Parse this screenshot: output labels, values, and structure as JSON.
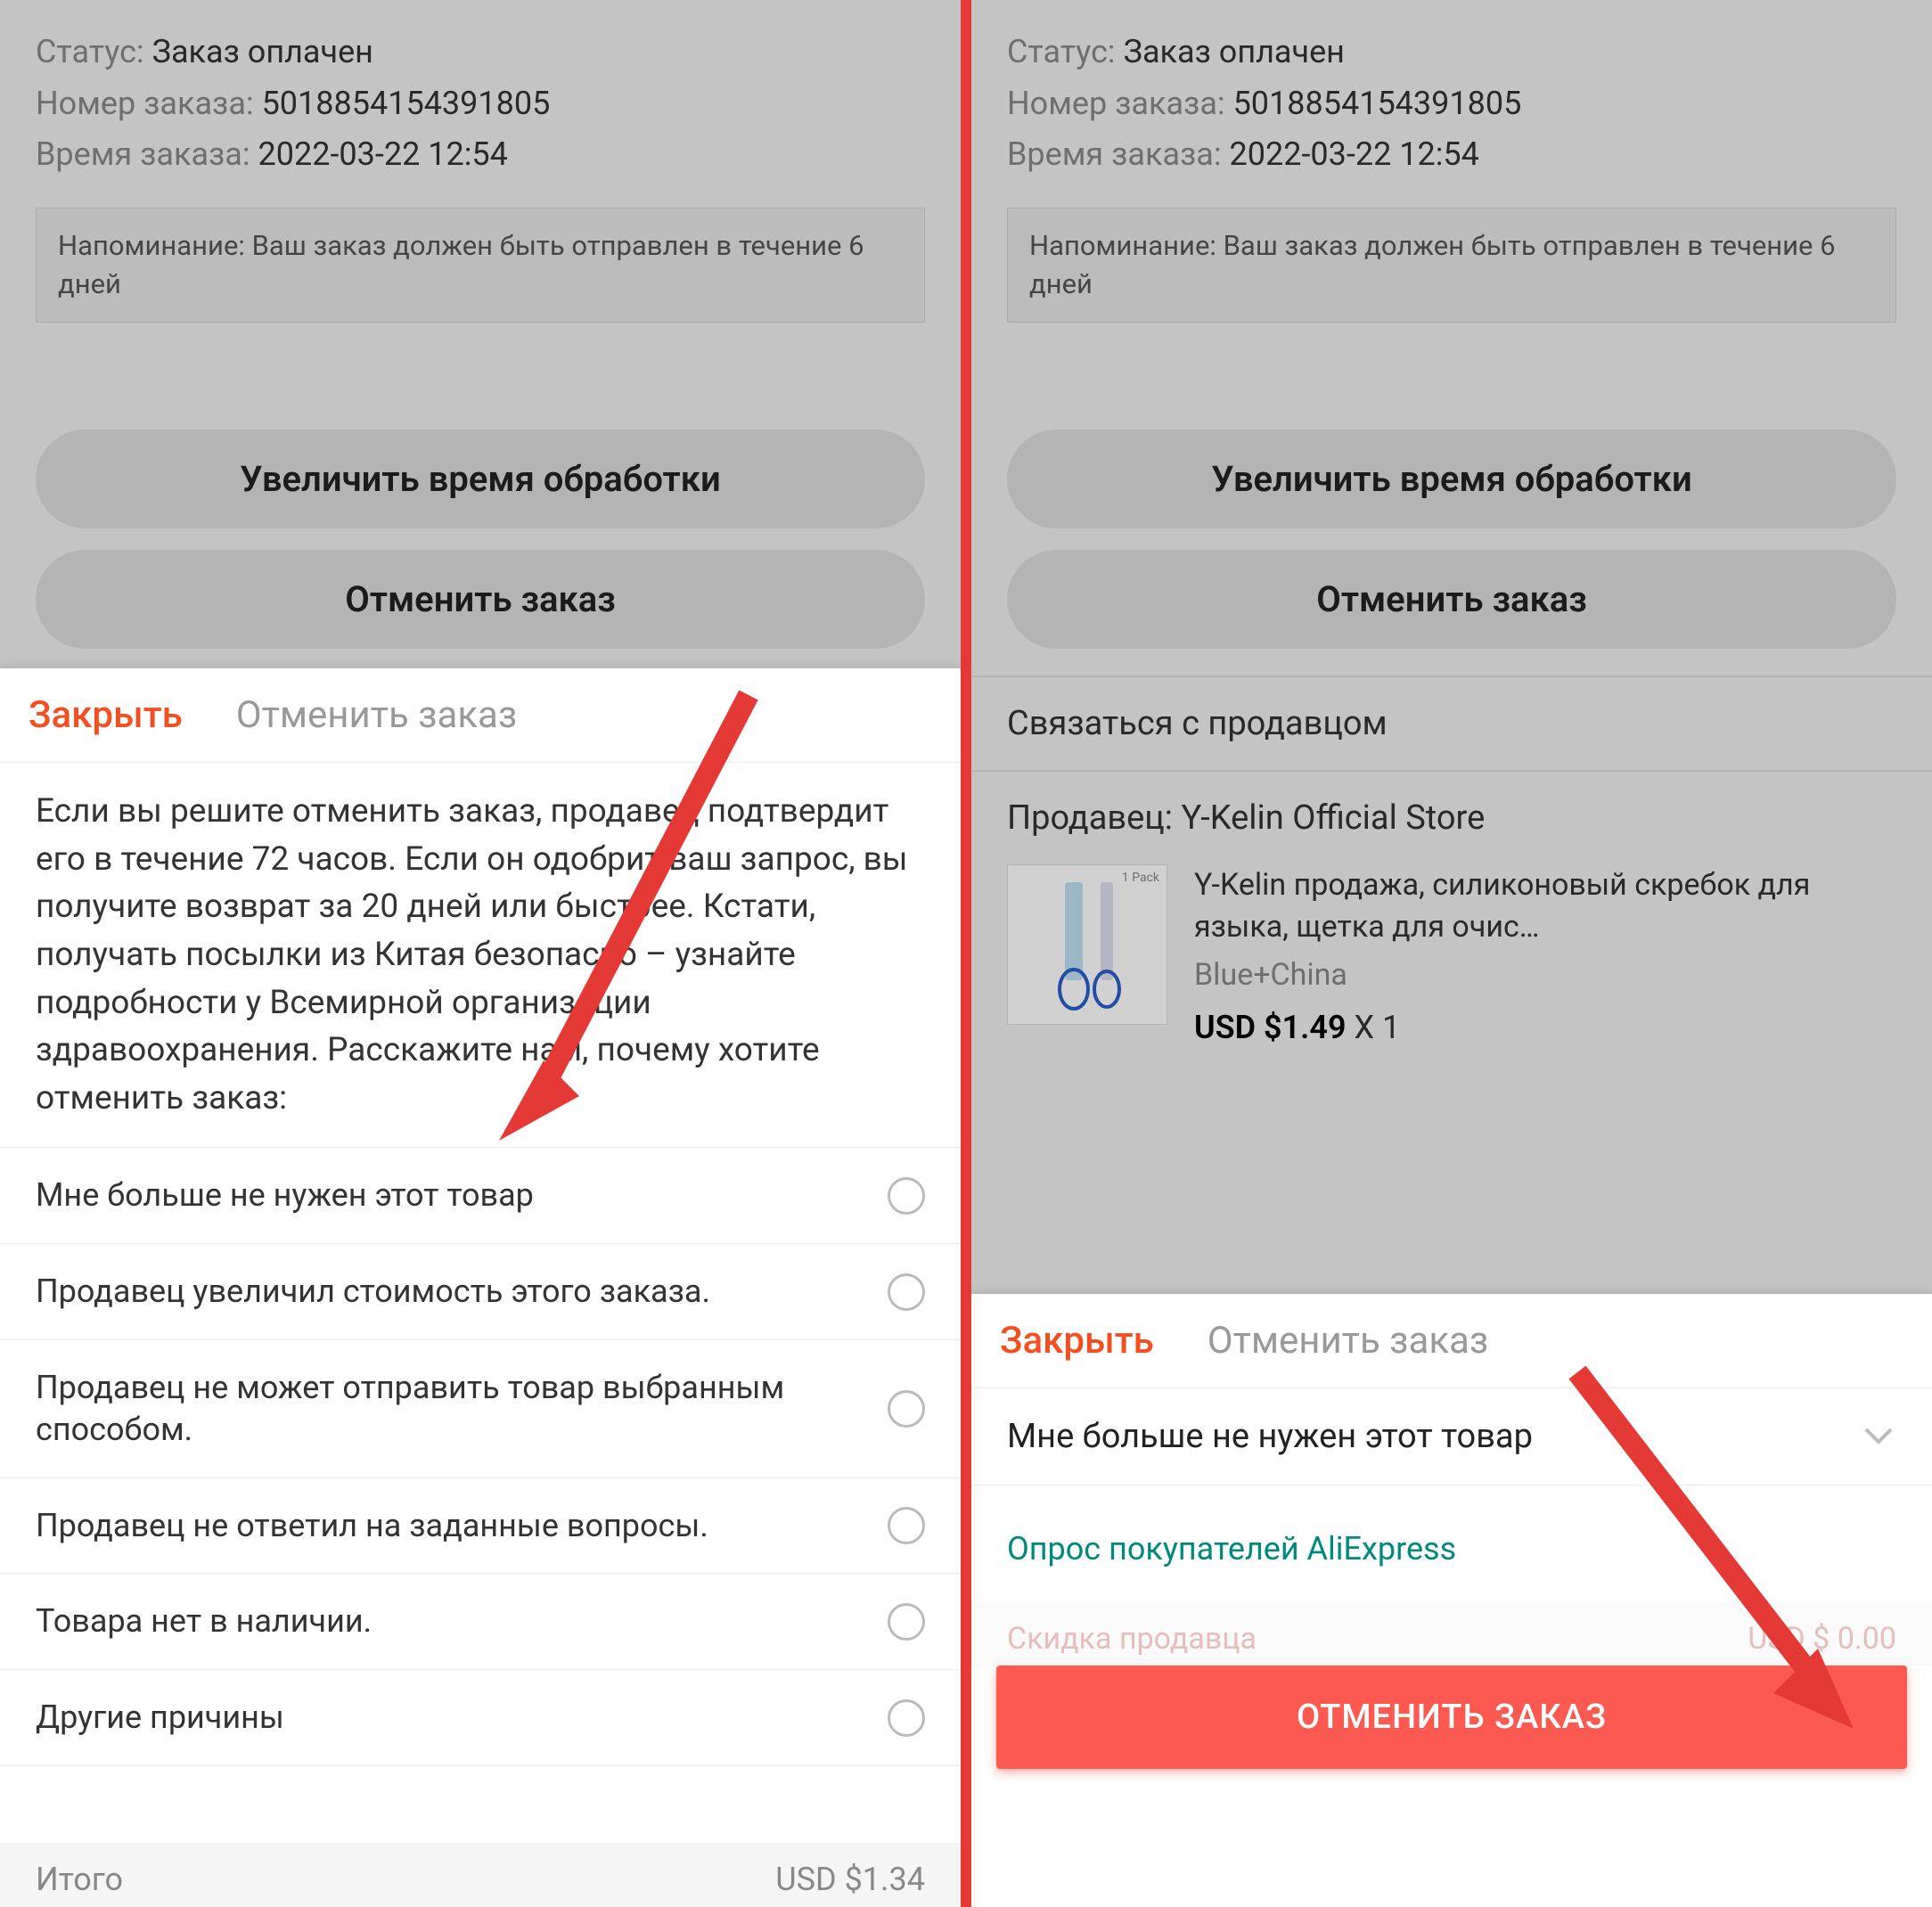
{
  "order": {
    "status_label": "Статус:",
    "status_value": "Заказ оплачен",
    "number_label": "Номер заказа:",
    "number_value": "5018854154391805",
    "time_label": "Время заказа:",
    "time_value": "2022-03-22 12:54",
    "reminder": "Напоминание: Ваш заказ должен быть отправлен в течение 6 дней"
  },
  "buttons": {
    "extend": "Увеличить время обработки",
    "cancel": "Отменить заказ"
  },
  "links": {
    "contact_seller": "Связаться с продавцом"
  },
  "seller": {
    "label": "Продавец:",
    "name": "Y-Kelin Official Store"
  },
  "product": {
    "pack_label": "1 Pack",
    "title": "Y-Kelin продажа, силиконовый скребок для языка, щетка для очис…",
    "variant": "Blue+China",
    "price": "USD $1.49",
    "qty": "X 1"
  },
  "sheet": {
    "close": "Закрыть",
    "title": "Отменить заказ",
    "description": "Если вы решите отменить заказ, продавец подтвердит его в течение 72 часов. Если он одобрит ваш запрос, вы получите возврат за 20 дней или быстрее. Кстати, получать посылки из Китая безопасно – узнайте подробности у Всемирной организации здравоохранения. Расскажите нам, почему хотите отменить заказ:",
    "reasons": [
      "Мне больше не нужен этот товар",
      "Продавец увеличил стоимость этого заказа.",
      "Продавец не может отправить товар выбранным способом.",
      "Продавец не ответил на заданные вопросы.",
      "Товара нет в наличии.",
      "Другие причины"
    ],
    "selected_reason": "Мне больше не нужен этот товар",
    "survey": "Опрос покупателей AliExpress",
    "cta": "ОТМЕНИТЬ ЗАКАЗ"
  },
  "footer": {
    "total_label": "Итого",
    "total_value": "USD $1.34",
    "discount_label": "Скидка продавца",
    "discount_value": "USD $ 0.00"
  }
}
